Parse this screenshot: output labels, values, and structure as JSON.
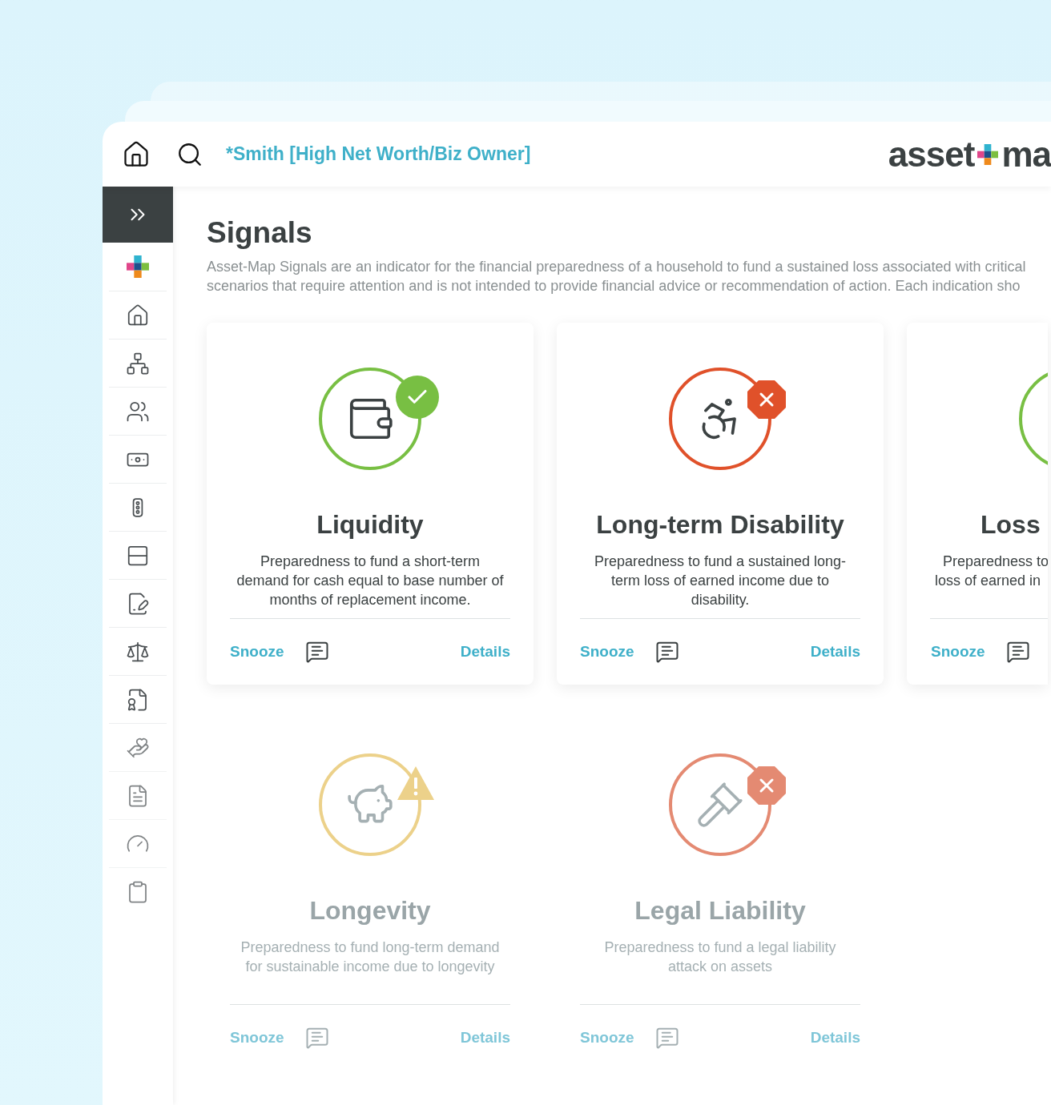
{
  "header": {
    "household": "*Smith [High Net Worth/Biz Owner]",
    "logo_left": "asset",
    "logo_right": "ma"
  },
  "page": {
    "title": "Signals",
    "description_lines": [
      "Asset-Map Signals are an indicator for the financial preparedness of a household to fund a sustained loss associated with critical",
      "scenarios that require attention and is not intended to provide financial advice or recommendation of action. Each indication sho"
    ]
  },
  "cards": [
    {
      "kind": "pass",
      "color": "#78bf43",
      "faded": false,
      "title": "Liquidity",
      "description": "Preparedness to fund a short-term demand for cash equal to base number of months of replacement income.",
      "snooze": "Snooze",
      "details": "Details"
    },
    {
      "kind": "fail",
      "color": "#e0512a",
      "faded": false,
      "title": "Long-term Disability",
      "description": "Preparedness to fund a sustained long-term loss of earned income due to disability.",
      "snooze": "Snooze",
      "details": "Details"
    },
    {
      "kind": "cut",
      "color": "#78bf43",
      "faded": false,
      "title": "Loss",
      "description_lines": [
        "Preparedness to",
        "loss of earned in"
      ],
      "snooze": "Snooze"
    },
    {
      "kind": "warn",
      "color": "#ecd18a",
      "faded": true,
      "title": "Longevity",
      "description": "Preparedness to fund long-term demand for sustainable income due to longevity",
      "snooze": "Snooze",
      "details": "Details"
    },
    {
      "kind": "fail",
      "color": "#e48a72",
      "faded": true,
      "title": "Legal Liability",
      "description": "Preparedness to fund a legal liability attack on assets",
      "snooze": "Snooze",
      "details": "Details"
    }
  ]
}
